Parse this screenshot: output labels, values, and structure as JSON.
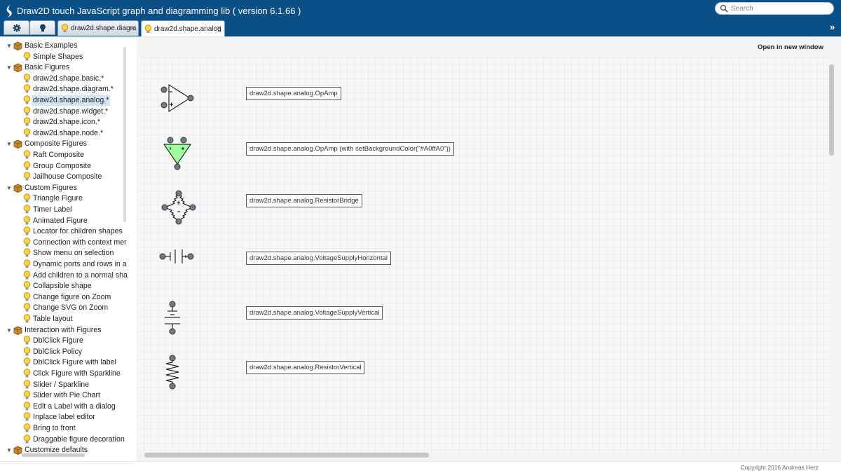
{
  "header": {
    "title": "Draw2D touch JavaScript graph and diagramming lib ( version 6.1.66 )",
    "search_placeholder": "Search"
  },
  "tabs": [
    {
      "label": "draw2d.shape.diagra",
      "active": false
    },
    {
      "label": "draw2d.shape.analog",
      "active": true
    }
  ],
  "sidebar": {
    "rows": [
      {
        "type": "folder",
        "label": "Basic Examples"
      },
      {
        "type": "leaf",
        "label": "Simple Shapes"
      },
      {
        "type": "folder",
        "label": "Basic Figures"
      },
      {
        "type": "leaf",
        "label": "draw2d.shape.basic.*"
      },
      {
        "type": "leaf",
        "label": "draw2d.shape.diagram.*"
      },
      {
        "type": "leaf",
        "label": "draw2d.shape.analog.*",
        "selected": true
      },
      {
        "type": "leaf",
        "label": "draw2d.shape.widget.*"
      },
      {
        "type": "leaf",
        "label": "draw2d.shape.icon.*"
      },
      {
        "type": "leaf",
        "label": "draw2d.shape.node.*"
      },
      {
        "type": "folder",
        "label": "Composite Figures"
      },
      {
        "type": "leaf",
        "label": "Raft Composite"
      },
      {
        "type": "leaf",
        "label": "Group Composite"
      },
      {
        "type": "leaf",
        "label": "Jailhouse Composite"
      },
      {
        "type": "folder",
        "label": "Custom Figures"
      },
      {
        "type": "leaf",
        "label": "Triangle Figure"
      },
      {
        "type": "leaf",
        "label": "Timer Label"
      },
      {
        "type": "leaf",
        "label": "Animated Figure"
      },
      {
        "type": "leaf",
        "label": "Locator for children shapes"
      },
      {
        "type": "leaf",
        "label": "Connection with context mer"
      },
      {
        "type": "leaf",
        "label": "Show menu on selection"
      },
      {
        "type": "leaf",
        "label": "Dynamic ports and rows in a"
      },
      {
        "type": "leaf",
        "label": "Add children to a normal sha"
      },
      {
        "type": "leaf",
        "label": "Collapsible shape"
      },
      {
        "type": "leaf",
        "label": "Change figure on Zoom"
      },
      {
        "type": "leaf",
        "label": "Change SVG on Zoom"
      },
      {
        "type": "leaf",
        "label": "Table layout"
      },
      {
        "type": "folder",
        "label": "Interaction with Figures"
      },
      {
        "type": "leaf",
        "label": "DblClick Figure"
      },
      {
        "type": "leaf",
        "label": "DblClick Policy"
      },
      {
        "type": "leaf",
        "label": "DblClick Figure with label"
      },
      {
        "type": "leaf",
        "label": "Click Figure with Sparkline"
      },
      {
        "type": "leaf",
        "label": "Slider / Sparkline"
      },
      {
        "type": "leaf",
        "label": "Slider with Pie Chart"
      },
      {
        "type": "leaf",
        "label": "Edit a Label with a dialog"
      },
      {
        "type": "leaf",
        "label": "Inplace label editor"
      },
      {
        "type": "leaf",
        "label": "Bring to front"
      },
      {
        "type": "leaf",
        "label": "Draggable figure decoration"
      },
      {
        "type": "folder",
        "label": "Customize defaults"
      }
    ]
  },
  "main": {
    "open_new_window": "Open in new window",
    "shapes": [
      {
        "label": "draw2d.shape.analog.OpAmp"
      },
      {
        "label": "draw2d.shape.analog.OpAmp (with setBackgroundColor(\"#A0ffA0\"))"
      },
      {
        "label": "draw2d.shape.analog.ResistorBridge"
      },
      {
        "label": "draw2d.shape.analog.VoltageSupplyHorizontal"
      },
      {
        "label": "draw2d.shape.analog.VoltageSupplyVertical"
      },
      {
        "label": "draw2d.shape.analog.ResistorVertical"
      }
    ]
  },
  "footer": {
    "copyright": "Copyright 2016 Andreas Herz"
  },
  "colors": {
    "header_bg": "#0b4f87",
    "selected_bg": "#d3e4f5",
    "opamp_fill": "#A0ffA0",
    "port_fill": "#6f7b83"
  }
}
